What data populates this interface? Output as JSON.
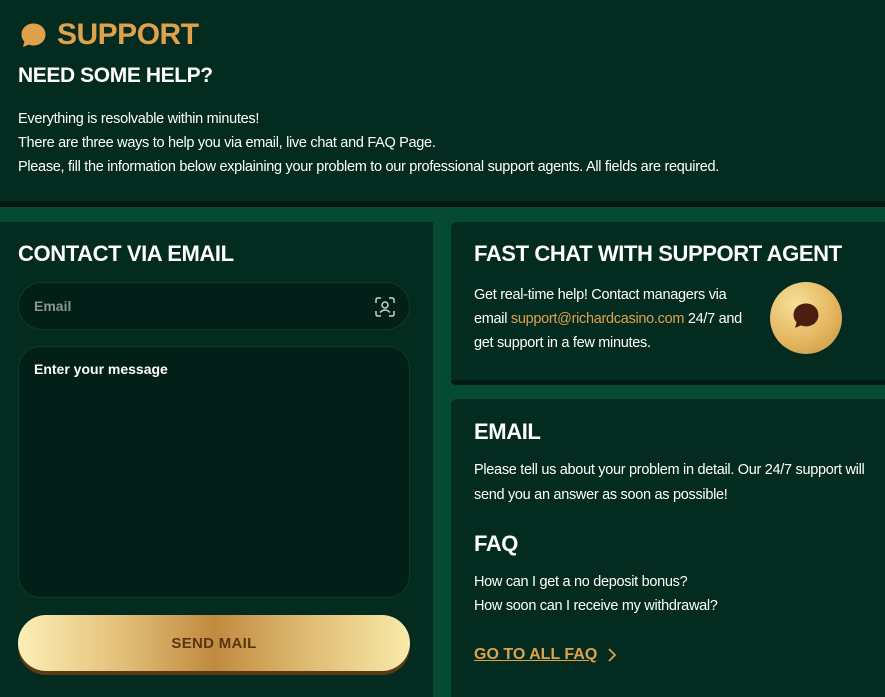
{
  "header": {
    "title": "SUPPORT",
    "subtitle": "NEED SOME HELP?",
    "intro_lines": [
      "Everything is resolvable within minutes!",
      "There are three ways to help you via email, live chat and FAQ Page.",
      "Please, fill the information below explaining your problem to our professional support agents. All fields are required."
    ]
  },
  "contact": {
    "title": "CONTACT VIA EMAIL",
    "email_placeholder": "Email",
    "message_placeholder": "Enter your message",
    "send_label": "SEND MAIL"
  },
  "chat": {
    "title": "FAST CHAT WITH SUPPORT AGENT",
    "text_before": "Get real-time help! Contact managers via email ",
    "email_link": "support@richardcasino.com",
    "text_after": " 24/7 and get support in a few minutes."
  },
  "email_section": {
    "title": "EMAIL",
    "text": "Please tell us about your problem in detail. Our 24/7 support will send you an answer as soon as possible!"
  },
  "faq": {
    "title": "FAQ",
    "questions": [
      "How can I get a no deposit bonus?",
      "How soon can I receive my withdrawal?"
    ],
    "link_label": "GO TO ALL FAQ"
  },
  "icons": {
    "support": "chat-bubble-icon",
    "email_field": "user-scan-icon",
    "chat_button": "chat-bubble-icon",
    "faq_link": "chevron-right-icon"
  },
  "colors": {
    "page_bg": "#054a33",
    "panel_bg": "#032b20",
    "accent": "#e0a14b",
    "button_text": "#5b3510"
  }
}
